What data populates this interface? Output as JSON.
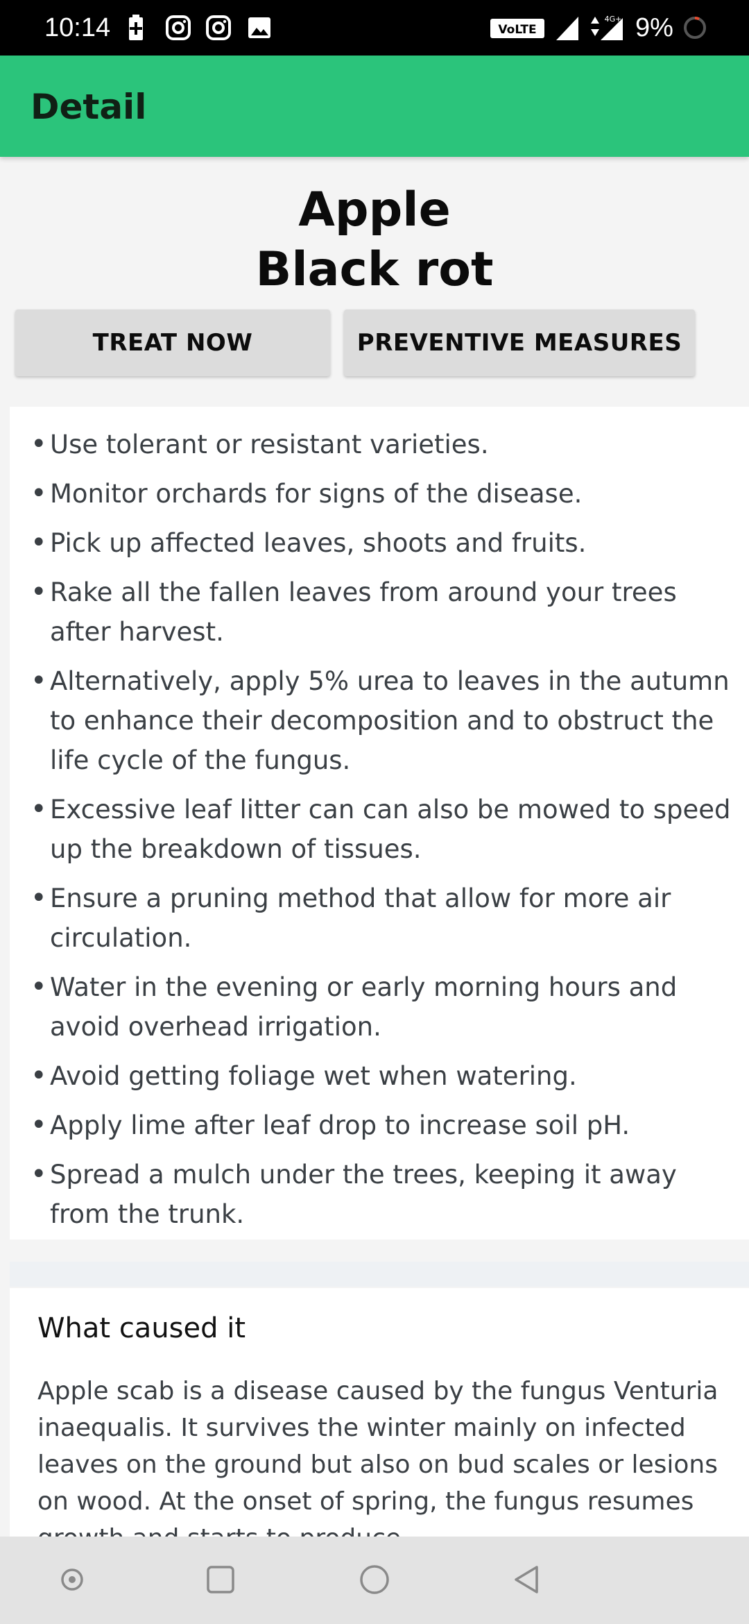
{
  "status_bar": {
    "time": "10:14",
    "battery": "9%",
    "network_badge": "VoLTE",
    "network_type": "4G+",
    "icons": [
      "battery-saver-icon",
      "instagram-icon",
      "instagram-icon",
      "gallery-icon",
      "volte-icon",
      "signal-icon",
      "signal-icon",
      "battery-circle-icon"
    ]
  },
  "app_bar": {
    "title": "Detail",
    "color": "#2bc47b"
  },
  "header": {
    "plant": "Apple",
    "disease": "Black rot"
  },
  "buttons": {
    "treat": "TREAT NOW",
    "preventive": "PREVENTIVE MEASURES"
  },
  "measures": [
    "Use tolerant or resistant varieties.",
    "Monitor orchards for signs of the disease.",
    "Pick up affected leaves, shoots and fruits.",
    "Rake all the fallen leaves from around your trees after harvest.",
    "Alternatively, apply 5% urea to leaves in the autumn to enhance their decomposition and to obstruct the life cycle of the fungus.",
    "Excessive leaf litter can can also be mowed to speed up the breakdown of tissues.",
    "Ensure a pruning method that allow for more air circulation.",
    "Water in the evening or early morning hours and avoid overhead irrigation.",
    "Avoid getting foliage wet when watering.",
    "Apply lime after leaf drop to increase soil pH.",
    "Spread a mulch under the trees, keeping it away from the trunk."
  ],
  "cause": {
    "heading": "What caused it",
    "body": "Apple scab is a disease caused by the fungus Venturia inaequalis. It survives the winter mainly on infected leaves on the ground but also on bud scales or lesions on wood. At the onset of spring, the fungus resumes growth and starts to produce"
  },
  "nav_bar": {
    "buttons": [
      "assistant-icon",
      "recents-icon",
      "home-icon",
      "back-icon"
    ]
  }
}
